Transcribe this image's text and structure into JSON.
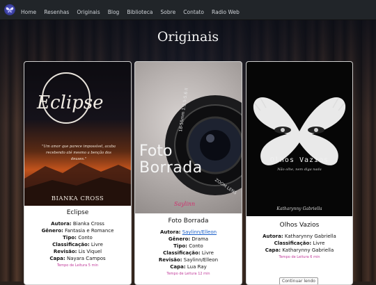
{
  "nav": {
    "logo_icon": "butterfly-logo",
    "items": [
      "Home",
      "Resenhas",
      "Originais",
      "Blog",
      "Biblioteca",
      "Sobre",
      "Contato",
      "Radio Web"
    ]
  },
  "page": {
    "title": "Originais"
  },
  "cards": [
    {
      "cover_title": "Eclipse",
      "cover_quote": "\"Um amor que parece impossível, acaba recebendo até mesmo a benção dos deuses.\"",
      "cover_author": "BIANKA CROSS",
      "title": "Eclipse",
      "rows": [
        {
          "label": "Autora:",
          "value": "Bianka Cross"
        },
        {
          "label": "Gênero:",
          "value": "Fantasia e Romance"
        },
        {
          "label": "Tipo:",
          "value": "Conto"
        },
        {
          "label": "Classificação:",
          "value": "Livre"
        },
        {
          "label": "Revisão:",
          "value": "Lis Viquel"
        },
        {
          "label": "Capa:",
          "value": "Nayara Campos"
        }
      ],
      "time": "Tempo de Leitura 5 min"
    },
    {
      "cover_title_1": "Foto",
      "cover_title_2": "Borrada",
      "cover_lens": "18-55mm 1:3.5-5.6 II",
      "cover_lens2": "ZOOM LENS",
      "cover_sign": "Saylinn",
      "title": "Foto Borrada",
      "rows": [
        {
          "label": "Autora:",
          "value": "Saylinn/Elleon"
        },
        {
          "label": "Gênero:",
          "value": "Drama"
        },
        {
          "label": "Tipo:",
          "value": "Conto"
        },
        {
          "label": "Classificação:",
          "value": "Livre"
        },
        {
          "label": "Revisão:",
          "value": "Saylinn/Elleon"
        },
        {
          "label": "Capa:",
          "value": "Lua Ray"
        }
      ],
      "time": "Tempo de Leitura 12 min"
    },
    {
      "cover_title": "Olhos Vazios",
      "cover_sub": "Não olhe, nem diga nada",
      "cover_author": "Katharynny Gabriella",
      "title": "Olhos Vazios",
      "rows": [
        {
          "label": "Autora:",
          "value": "Katharynny Gabriella"
        },
        {
          "label": "Classificação:",
          "value": "Livre"
        },
        {
          "label": "Capa:",
          "value": "Katharynny Gabriella"
        }
      ],
      "time": "Tempo de Leitura 6 min",
      "button": "Continuar lendo"
    }
  ]
}
